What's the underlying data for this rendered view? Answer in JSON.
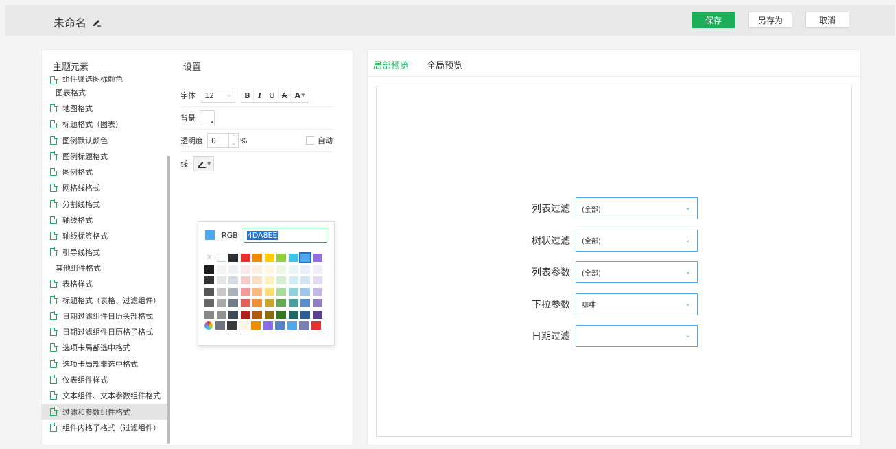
{
  "header": {
    "doc_title": "未命名",
    "save": "保存",
    "save_as": "另存为",
    "cancel": "取消"
  },
  "left": {
    "theme_elements_title": "主题元素",
    "settings_title": "设置",
    "tree": [
      {
        "label": "组件筛选图标颜色",
        "type": "item",
        "partial": true
      },
      {
        "label": "图表格式",
        "type": "group"
      },
      {
        "label": "地图格式",
        "type": "item"
      },
      {
        "label": "标题格式（图表）",
        "type": "item"
      },
      {
        "label": "图例默认颜色",
        "type": "item"
      },
      {
        "label": "图例标题格式",
        "type": "item"
      },
      {
        "label": "图例格式",
        "type": "item"
      },
      {
        "label": "网格线格式",
        "type": "item"
      },
      {
        "label": "分割线格式",
        "type": "item"
      },
      {
        "label": "轴线格式",
        "type": "item"
      },
      {
        "label": "轴线标签格式",
        "type": "item"
      },
      {
        "label": "引导线格式",
        "type": "item"
      },
      {
        "label": "其他组件格式",
        "type": "group"
      },
      {
        "label": "表格样式",
        "type": "item"
      },
      {
        "label": "标题格式（表格、过滤组件）",
        "type": "item"
      },
      {
        "label": "日期过滤组件日历头部格式",
        "type": "item"
      },
      {
        "label": "日期过滤组件日历格子格式",
        "type": "item"
      },
      {
        "label": "选项卡局部选中格式",
        "type": "item"
      },
      {
        "label": "选项卡局部非选中格式",
        "type": "item"
      },
      {
        "label": "仪表组件样式",
        "type": "item"
      },
      {
        "label": "文本组件、文本参数组件格式",
        "type": "item"
      },
      {
        "label": "过滤和参数组件格式",
        "type": "item",
        "active": true
      },
      {
        "label": "组件内格子格式（过滤组件）",
        "type": "item"
      }
    ],
    "settings": {
      "font_label": "字体",
      "font_size": "12",
      "format_buttons": [
        "B",
        "I",
        "U",
        "A",
        "A"
      ],
      "background_label": "背景",
      "opacity_label": "透明度",
      "opacity_value": "0",
      "percent": "%",
      "auto_label": "自动",
      "line_label": "线"
    },
    "color_picker": {
      "rgb_label": "RGB",
      "rgb_value": "4DA8EE",
      "selected_color": "#4DA8EE",
      "rows": [
        [
          "none",
          "#ffffff",
          "#2b2f36",
          "#e8312f",
          "#f08c00",
          "#ffcc00",
          "#8fd13f",
          "#3ec4e8",
          "#4DA8EE",
          "#9370db"
        ],
        [
          "#1e1e1e",
          "#f4f4f4",
          "#eef2f6",
          "#fbeaea",
          "#fdf0e1",
          "#fff7e0",
          "#eef7e6",
          "#e9f6f9",
          "#e8f1fb",
          "#f2effa"
        ],
        [
          "#333333",
          "#e6e6e6",
          "#d5dbe3",
          "#f6cccc",
          "#fbdfc4",
          "#fff0bf",
          "#d6efd0",
          "#d0edf3",
          "#d3e5f5",
          "#e2dcf3"
        ],
        [
          "#555555",
          "#c8c8c8",
          "#a8b1bc",
          "#f29b99",
          "#f9ba82",
          "#f7dd73",
          "#a7dc9a",
          "#8fd2dc",
          "#9ec6e8",
          "#c3b7e3"
        ],
        [
          "#666666",
          "#a8a8a8",
          "#707c88",
          "#e0605c",
          "#ef8f3a",
          "#c9a633",
          "#62ab52",
          "#4a9e9e",
          "#5a8ecb",
          "#8f7fc0"
        ],
        [
          "#888888",
          "#909090",
          "#3e4a57",
          "#b0211e",
          "#b25a0c",
          "#8a6e0d",
          "#33781f",
          "#1f6a68",
          "#2e5e95",
          "#5d3f8f"
        ],
        [
          "wheel",
          "#6e7580",
          "#3a3a3a",
          "#fdf5e4",
          "#f08c00",
          "#8a6ee8",
          "#5584c4",
          "#4DA8EE",
          "#7b7fb6",
          "#e8312f"
        ]
      ]
    }
  },
  "right": {
    "tabs": [
      "局部预览",
      "全局预览"
    ],
    "filters": [
      {
        "label": "列表过滤",
        "value": "(全部)"
      },
      {
        "label": "树状过滤",
        "value": "(全部)"
      },
      {
        "label": "列表参数",
        "value": "(全部)"
      },
      {
        "label": "下拉参数",
        "value": "咖啡"
      },
      {
        "label": "日期过滤",
        "value": ""
      }
    ]
  }
}
